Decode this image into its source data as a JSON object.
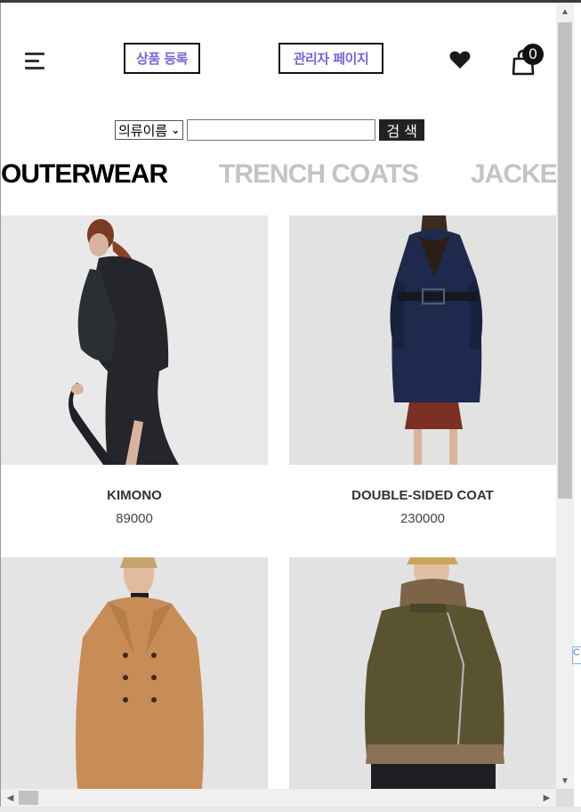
{
  "header": {
    "register_label": "상품 등록",
    "admin_label": "관리자 페이지",
    "cart_count": "0"
  },
  "search": {
    "select_value": "의류이름",
    "input_value": "",
    "button_label": "검 색"
  },
  "categories": [
    "OUTERWEAR",
    "TRENCH COATS",
    "JACKE"
  ],
  "products": [
    {
      "name": "KIMONO",
      "price": "89000"
    },
    {
      "name": "DOUBLE-SIDED COAT",
      "price": "230000"
    }
  ],
  "colors": {
    "accent": "#7a63d8",
    "active_category": "#000000",
    "inactive_category": "#c3c3c8"
  }
}
